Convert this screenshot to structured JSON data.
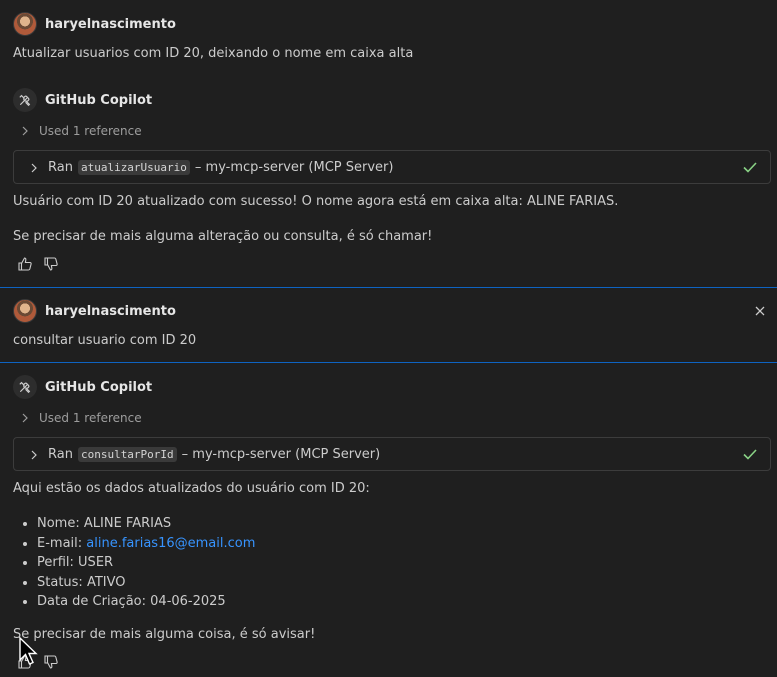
{
  "conversation": [
    {
      "user": {
        "name": "haryelnascimento",
        "message": "Atualizar usuarios com ID 20, deixando o nome em caixa alta"
      },
      "assistant": {
        "name": "GitHub Copilot",
        "reference": "Used 1 reference",
        "tool": {
          "prefix": "Ran",
          "name": "atualizarUsuario",
          "suffix": "– my-mcp-server (MCP Server)"
        },
        "paragraphs": [
          "Usuário com ID 20 atualizado com sucesso! O nome agora está em caixa alta: ALINE FARIAS.",
          "Se precisar de mais alguma alteração ou consulta, é só chamar!"
        ]
      }
    },
    {
      "user": {
        "name": "haryelnascimento",
        "message": "consultar usuario com ID 20"
      },
      "assistant": {
        "name": "GitHub Copilot",
        "reference": "Used 1 reference",
        "tool": {
          "prefix": "Ran",
          "name": "consultarPorId",
          "suffix": "– my-mcp-server (MCP Server)"
        },
        "intro": "Aqui estão os dados atualizados do usuário com ID 20:",
        "list": {
          "nome_label": "Nome:",
          "nome_value": "ALINE FARIAS",
          "email_label": "E-mail:",
          "email_value": "aline.farias16@email.com",
          "perfil_label": "Perfil:",
          "perfil_value": "USER",
          "status_label": "Status:",
          "status_value": "ATIVO",
          "data_label": "Data de Criação:",
          "data_value": "04-06-2025"
        },
        "outro": "Se precisar de mais alguma coisa, é só avisar!"
      }
    }
  ],
  "colors": {
    "accent": "#0e63c1",
    "link": "#3794ff",
    "check": "#89d185",
    "background": "#1f1f1f"
  },
  "icons": [
    "copilot-tools-icon",
    "chevron-right-icon",
    "check-icon",
    "thumbs-up-icon",
    "thumbs-down-icon",
    "close-icon",
    "mouse-cursor-icon"
  ]
}
